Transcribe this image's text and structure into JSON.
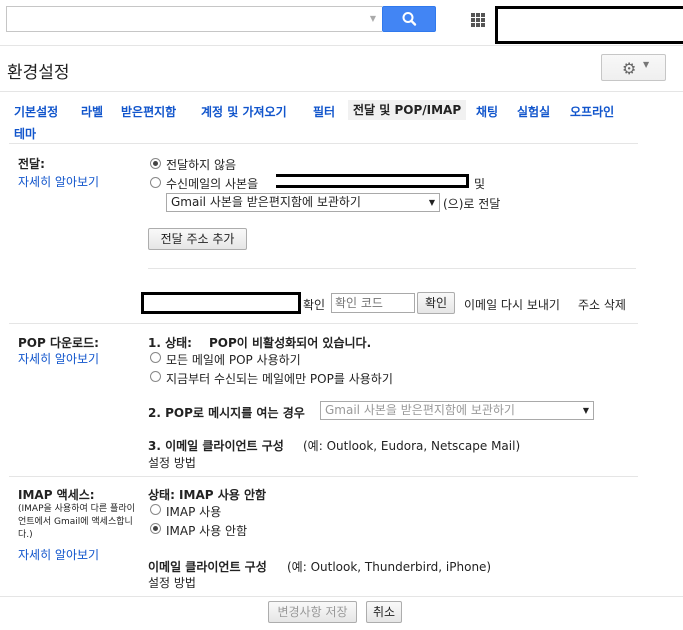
{
  "search": {
    "placeholder": ""
  },
  "header": {
    "title": "환경설정"
  },
  "tabs": [
    {
      "label": "기본설정"
    },
    {
      "label": "라벨"
    },
    {
      "label": "받은편지함"
    },
    {
      "label": "계정 및 가져오기"
    },
    {
      "label": "필터"
    },
    {
      "label": "전달 및 POP/IMAP"
    },
    {
      "label": "채팅"
    },
    {
      "label": "실험실"
    },
    {
      "label": "오프라인"
    },
    {
      "label": "테마"
    }
  ],
  "forwarding": {
    "label": "전달:",
    "learn_more": "자세히 알아보기",
    "option_disable": "전달하지 않음",
    "option_forward_prefix": "수신메일의 사본을",
    "and": "및",
    "action_select": "Gmail 사본을 받은편지함에 보관하기",
    "action_suffix": "(으)로 전달",
    "add_address_button": "전달 주소 추가",
    "confirm_label": "확인",
    "confirm_code_placeholder": "확인 코드",
    "confirm_button": "확인",
    "resend_link": "이메일 다시 보내기",
    "delete_link": "주소 삭제"
  },
  "pop": {
    "label": "POP 다운로드:",
    "learn_more": "자세히 알아보기",
    "status_prefix": "1. 상태: ",
    "status": "POP이 비활성화되어 있습니다.",
    "option_all": "모든 메일에 POP 사용하기",
    "option_new": "지금부터 수신되는 메일에만 POP를 사용하기",
    "when_label": "2. POP로 메시지를 여는 경우",
    "when_select": "Gmail 사본을 받은편지함에 보관하기",
    "client_label": "3. 이메일 클라이언트 구성",
    "client_examples": "(예: Outlook, Eudora, Netscape Mail)",
    "setup_link": "설정 방법"
  },
  "imap": {
    "label": "IMAP 액세스:",
    "note": "(IMAP을 사용하여 다른 플라이언트에서 Gmail에 액세스합니다.)",
    "learn_more": "자세히 알아보기",
    "status": "상태: IMAP 사용 안함",
    "option_enable": "IMAP 사용",
    "option_disable": "IMAP 사용 안함",
    "client_label": "이메일 클라이언트 구성",
    "client_examples": "(예: Outlook, Thunderbird, iPhone)",
    "setup_link": "설정 방법"
  },
  "footer": {
    "save_button": "변경사항 저장",
    "cancel_button": "취소"
  },
  "colors": {
    "accent": "#4285f4",
    "link": "#1155cc"
  }
}
